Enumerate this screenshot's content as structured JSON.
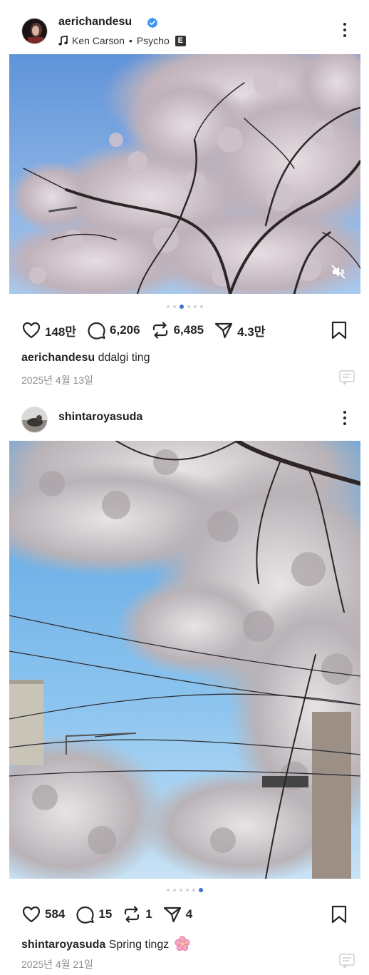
{
  "posts": [
    {
      "username": "aerichandesu",
      "verified": true,
      "music": {
        "artist": "Ken Carson",
        "separator": "•",
        "song": "Psycho",
        "explicit_label": "E"
      },
      "carousel": {
        "count": 6,
        "active_index": 2
      },
      "likes": "148만",
      "comments": "6,206",
      "reposts": "6,485",
      "shares": "4.3만",
      "caption": {
        "username": "aerichandesu",
        "text": "ddalgi ting"
      },
      "date": "2025년 4월 13일",
      "muted": true
    },
    {
      "username": "shintaroyasuda",
      "verified": false,
      "carousel": {
        "count": 6,
        "active_index": 5
      },
      "likes": "584",
      "comments": "15",
      "reposts": "1",
      "shares": "4",
      "caption": {
        "username": "shintaroyasuda",
        "text": "Spring tingz"
      },
      "date": "2025년 4월 21일"
    }
  ],
  "colors": {
    "accent": "#3f6fd6",
    "text": "#262626",
    "muted": "#8e8e8e",
    "verified": "#3897f0"
  }
}
